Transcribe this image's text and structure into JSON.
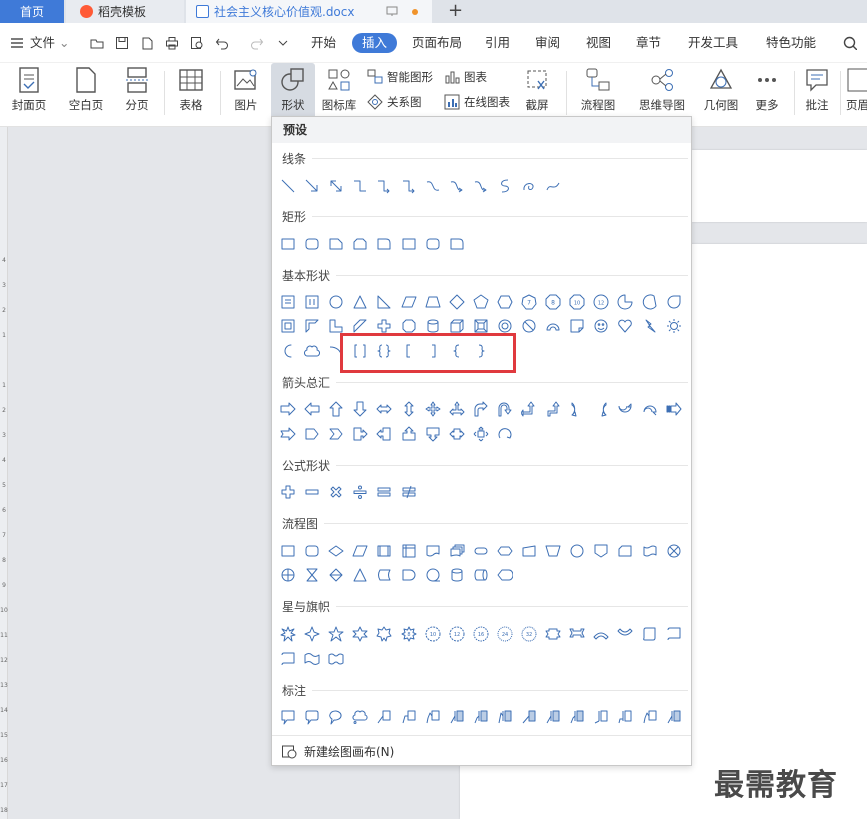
{
  "tabs": {
    "home": "首页",
    "template": "稻壳模板",
    "document": "社会主义核心价值观.docx"
  },
  "menu": {
    "file": "文件",
    "items": [
      "开始",
      "插入",
      "页面布局",
      "引用",
      "审阅",
      "视图",
      "章节",
      "开发工具",
      "特色功能"
    ],
    "active": "插入"
  },
  "ribbon": {
    "cover": "封面页",
    "blank": "空白页",
    "page_break": "分页",
    "table": "表格",
    "picture": "图片",
    "shape": "形状",
    "gallery": "图标库",
    "smartart": "智能图形",
    "chart": "图表",
    "relation": "关系图",
    "online_chart": "在线图表",
    "screenshot": "截屏",
    "flowchart": "流程图",
    "mindmap": "思维导图",
    "geometry": "几何图",
    "more": "更多",
    "comment": "批注",
    "header": "页眉"
  },
  "panel": {
    "header": "预设",
    "categories": [
      "线条",
      "矩形",
      "基本形状",
      "箭头总汇",
      "公式形状",
      "流程图",
      "星与旗帜",
      "标注"
    ],
    "footer": "新建绘图画布(N)"
  },
  "watermark": "最需教育",
  "colors": {
    "accent": "#3f7ad8",
    "shape_stroke": "#3d6fb4",
    "highlight": "#e0393e"
  }
}
